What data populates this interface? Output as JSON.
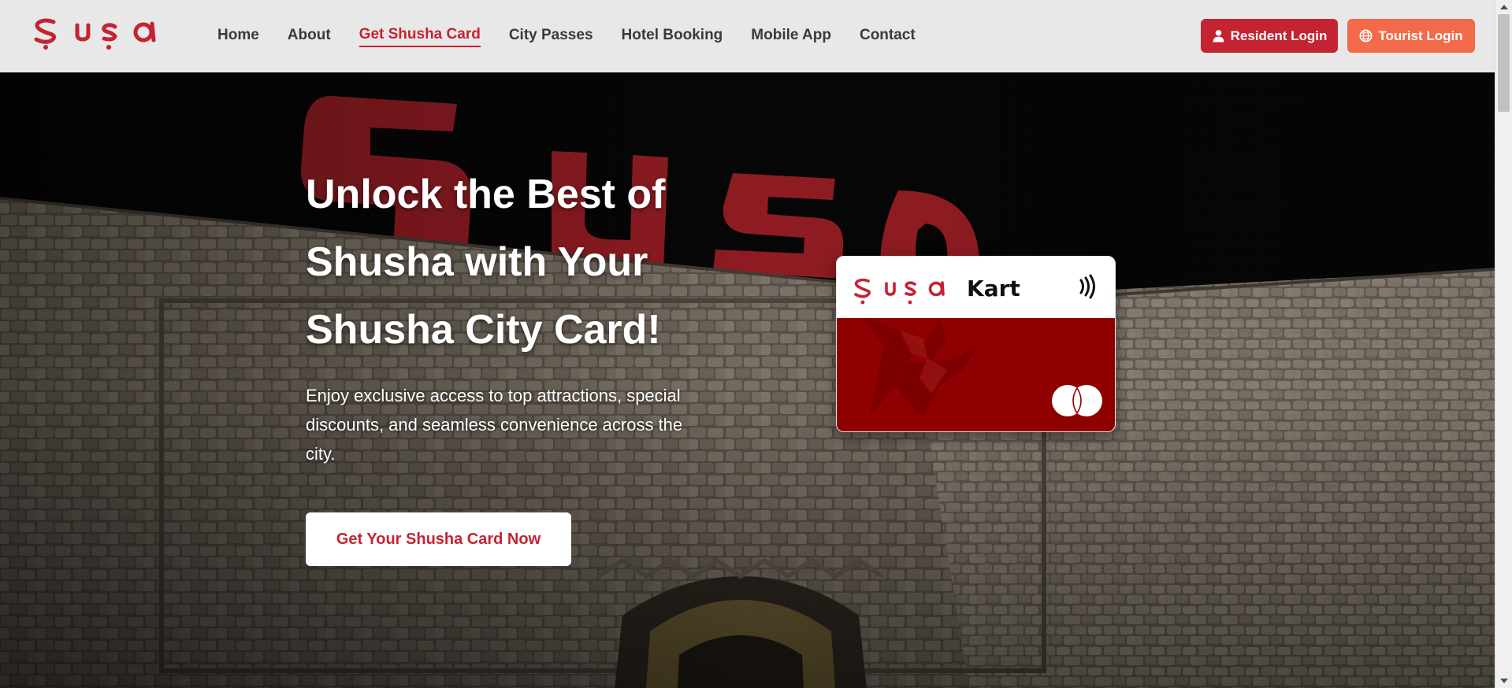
{
  "brand": {
    "logo_text": "Şuşa",
    "primary_color": "#c42332",
    "accent_color": "#f26a4a"
  },
  "nav": {
    "items": [
      {
        "label": "Home",
        "active": false
      },
      {
        "label": "About",
        "active": false
      },
      {
        "label": "Get Shusha Card",
        "active": true
      },
      {
        "label": "City Passes",
        "active": false
      },
      {
        "label": "Hotel Booking",
        "active": false
      },
      {
        "label": "Mobile App",
        "active": false
      },
      {
        "label": "Contact",
        "active": false
      }
    ]
  },
  "auth": {
    "resident_label": "Resident Login",
    "resident_icon": "user-icon",
    "tourist_label": "Tourist Login",
    "tourist_icon": "globe-icon"
  },
  "hero": {
    "title_line1": "Unlock the Best of",
    "title_line2": "Shusha with Your",
    "title_line3": "Shusha City Card!",
    "description": "Enjoy exclusive access to top attractions, special discounts, and seamless convenience across the city.",
    "cta_label": "Get Your Shusha Card Now",
    "background_sign_text": "Şuşa"
  },
  "card": {
    "logo_text": "Şuşa",
    "kart_label": "Kart",
    "contactless_icon": "contactless-icon",
    "network_icon": "mastercard-icon",
    "card_color": "#8f0000"
  }
}
